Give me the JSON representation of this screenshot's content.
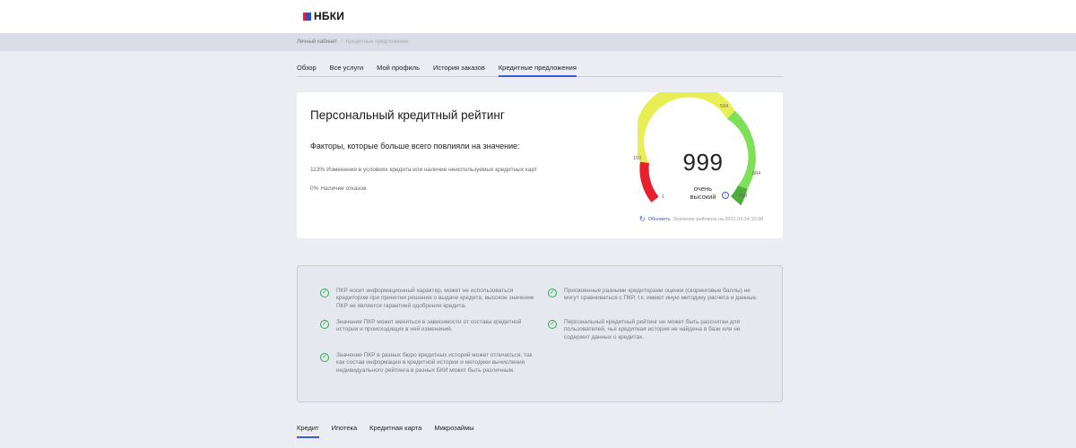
{
  "header": {
    "logo_text": "НБКИ"
  },
  "breadcrumb": {
    "items": [
      "Личный кабинет",
      "Кредитные предложения"
    ],
    "separator": "/"
  },
  "nav_tabs": [
    {
      "label": "Обзор",
      "active": false
    },
    {
      "label": "Все услуги",
      "active": false
    },
    {
      "label": "Мой профиль",
      "active": false
    },
    {
      "label": "История заказов",
      "active": false
    },
    {
      "label": "Кредитные предложения",
      "active": true
    }
  ],
  "rating_card": {
    "title": "Персональный кредитный рейтинг",
    "factors_title": "Факторы, которые больше всего повлияли на значение:",
    "factors": [
      {
        "percent": "113%",
        "text": "Изменения в условиях кредита или наличие неиспользуемых кредитных карт"
      },
      {
        "percent": "0%",
        "text": "Наличие отказов"
      }
    ],
    "refresh_label": "Обновить",
    "updated_text": "Значение рейтинга на 2022.04.14 10:08"
  },
  "gauge": {
    "score": "999",
    "label_line1": "очень",
    "label_line2": "высокий",
    "ticks": [
      "1",
      "150",
      "594",
      "884",
      "999"
    ],
    "segments_colors": [
      "#e8202e",
      "#e8ef55",
      "#7ee057",
      "#4cae3b"
    ]
  },
  "info_notes": [
    "ПКР носит информационный характер, может не использоваться кредитором при принятии решения о выдаче кредита, высокое значение ПКР не является гарантией одобрения кредита.",
    "Значение ПКР может меняться в зависимости от состава кредитной истории и происходящих в ней изменений.",
    "Значение ПКР в разных бюро кредитных историй может отличаться, так как состав информации в кредитной истории и методики вычисления индивидуального рейтинга в разных БКИ может быть различным.",
    "Присвоенные разными кредиторами оценки (скоринговые баллы) не могут сравниваться с ПКР, т.к. имеют иную методику расчета и данные.",
    "Персональный кредитный рейтинг не может быть рассчитан для пользователей, чья кредитная история не найдена в базе или не содержит данных о кредитах."
  ],
  "product_tabs": [
    {
      "label": "Кредит",
      "active": true
    },
    {
      "label": "Ипотека",
      "active": false
    },
    {
      "label": "Кредитная карта",
      "active": false
    },
    {
      "label": "Микрозаймы",
      "active": false
    }
  ]
}
